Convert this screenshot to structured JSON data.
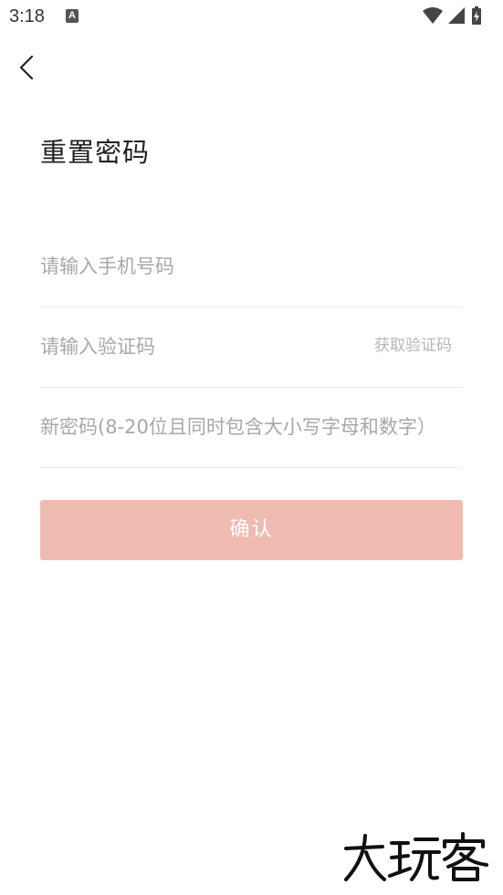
{
  "status_bar": {
    "time": "3:18",
    "notification_icon": "A",
    "icons": [
      "wifi-icon",
      "signal-icon",
      "battery-charging-icon"
    ]
  },
  "header": {
    "back_icon": "chevron-left-icon"
  },
  "page": {
    "title": "重置密码"
  },
  "form": {
    "phone_placeholder": "请输入手机号码",
    "phone_value": "",
    "code_placeholder": "请输入验证码",
    "code_value": "",
    "get_code_label": "获取验证码",
    "password_placeholder": "新密码(8-20位且同时包含大小写字母和数字）",
    "password_value": "",
    "confirm_label": "确认"
  },
  "colors": {
    "confirm_button_bg": "#f0bbb0",
    "placeholder_text": "#a8a8a8",
    "get_code_text": "#b5b5b5",
    "divider": "#eeeeee"
  },
  "watermark": {
    "text": "大玩客"
  }
}
